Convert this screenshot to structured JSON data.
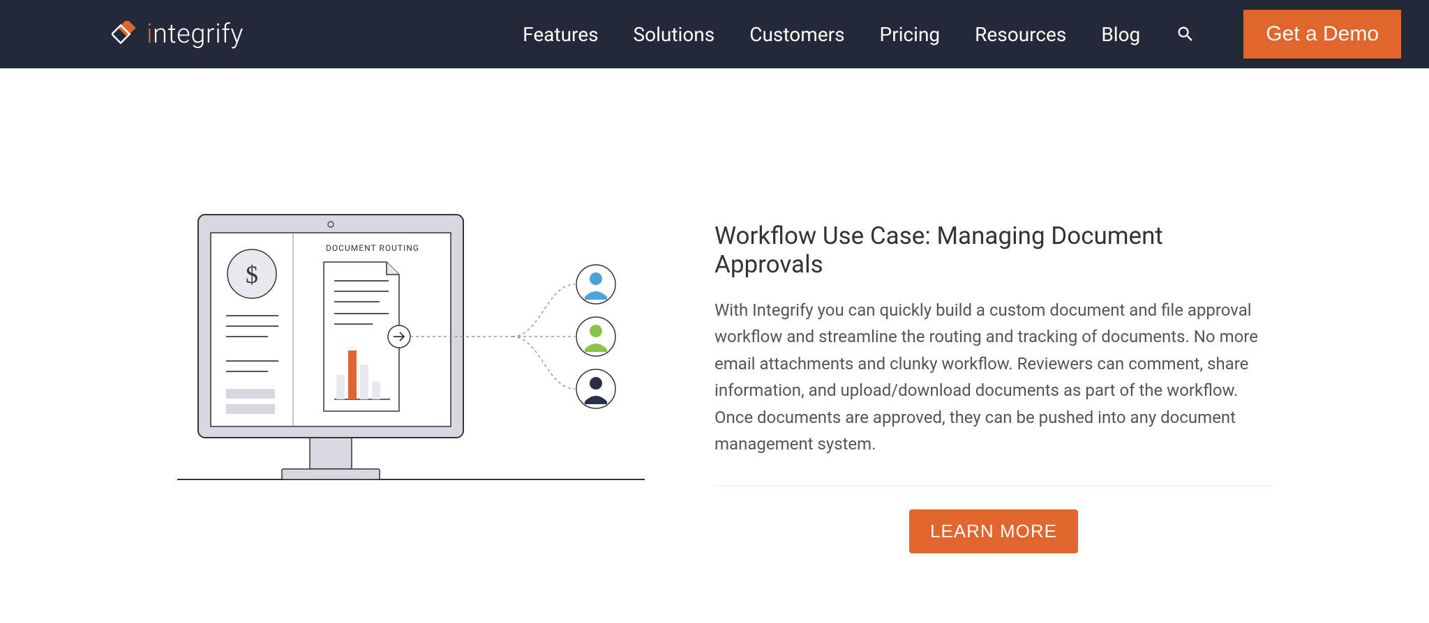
{
  "brand": {
    "name": "integrify"
  },
  "nav": {
    "items": [
      "Features",
      "Solutions",
      "Customers",
      "Pricing",
      "Resources",
      "Blog"
    ],
    "cta": "Get a Demo"
  },
  "main": {
    "heading": "Workflow Use Case: Managing Document Approvals",
    "body": "With Integrify you can quickly build a custom document and file approval workflow and streamline the routing and tracking of documents. No more email attachments and clunky workflow. Reviewers can comment, share information, and upload/download documents as part of the workflow. Once documents are approved, they can be pushed into any document management system.",
    "cta": "LEARN MORE",
    "illustration_label": "DOCUMENT ROUTING"
  },
  "colors": {
    "accent": "#e1662e",
    "header_bg": "#24293a"
  }
}
